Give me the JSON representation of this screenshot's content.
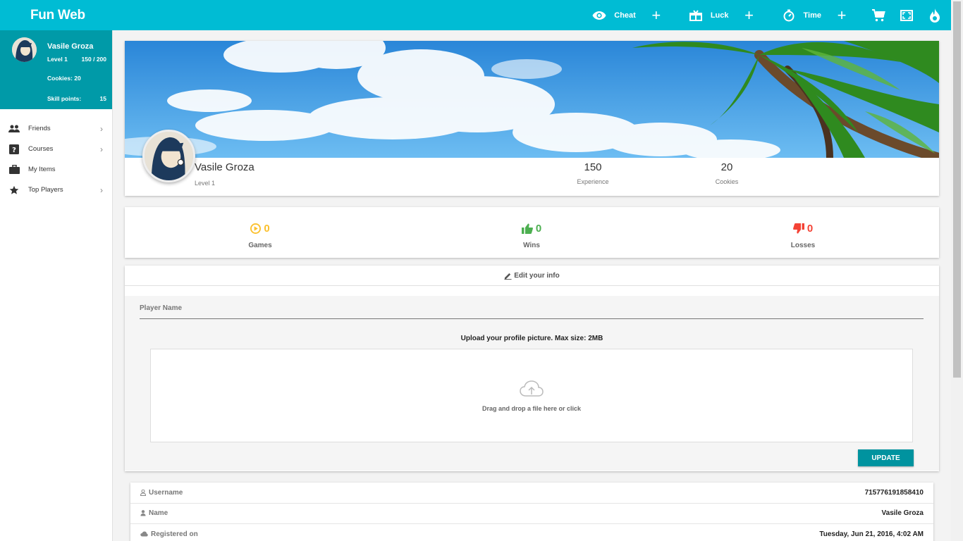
{
  "app": {
    "title": "Fun Web"
  },
  "topbar": {
    "cheat_label": "Cheat",
    "luck_label": "Luck",
    "time_label": "Time",
    "plus": "+"
  },
  "sidebar": {
    "user_name": "Vasile Groza",
    "level_label": "Level 1",
    "xp_progress": "150 / 200",
    "cookies_label": "Cookies: 20",
    "skill_label": "Skill points:",
    "skill_value": "15",
    "items": [
      {
        "label": "Friends",
        "icon": "people-icon",
        "has_chevron": true
      },
      {
        "label": "Courses",
        "icon": "help-box-icon",
        "has_chevron": true
      },
      {
        "label": "My Items",
        "icon": "briefcase-icon",
        "has_chevron": false
      },
      {
        "label": "Top Players",
        "icon": "star-icon",
        "has_chevron": true
      }
    ],
    "chevron": "›"
  },
  "profile": {
    "name": "Vasile Groza",
    "level": "Level 1",
    "experience_value": "150",
    "experience_label": "Experience",
    "cookies_value": "20",
    "cookies_label": "Cookies"
  },
  "game_stats": {
    "games_value": "0",
    "games_label": "Games",
    "games_color": "#fbc02d",
    "wins_value": "0",
    "wins_label": "Wins",
    "wins_color": "#4caf50",
    "losses_value": "0",
    "losses_label": "Losses",
    "losses_color": "#f44336"
  },
  "edit_form": {
    "header": "Edit your info",
    "player_name_label": "Player Name",
    "upload_title": "Upload your profile picture. Max size: 2MB",
    "dropzone_text": "Drag and drop a file here or click",
    "update_button": "UPDATE"
  },
  "info": {
    "username_label": "Username",
    "username_value": "715776191858410",
    "name_label": "Name",
    "name_value": "Vasile Groza",
    "registered_label": "Registered on",
    "registered_value": "Tuesday, Jun 21, 2016, 4:02 AM"
  },
  "colors": {
    "primary": "#00bcd4",
    "sidebar_profile": "#009aa8",
    "button": "#00939f"
  }
}
